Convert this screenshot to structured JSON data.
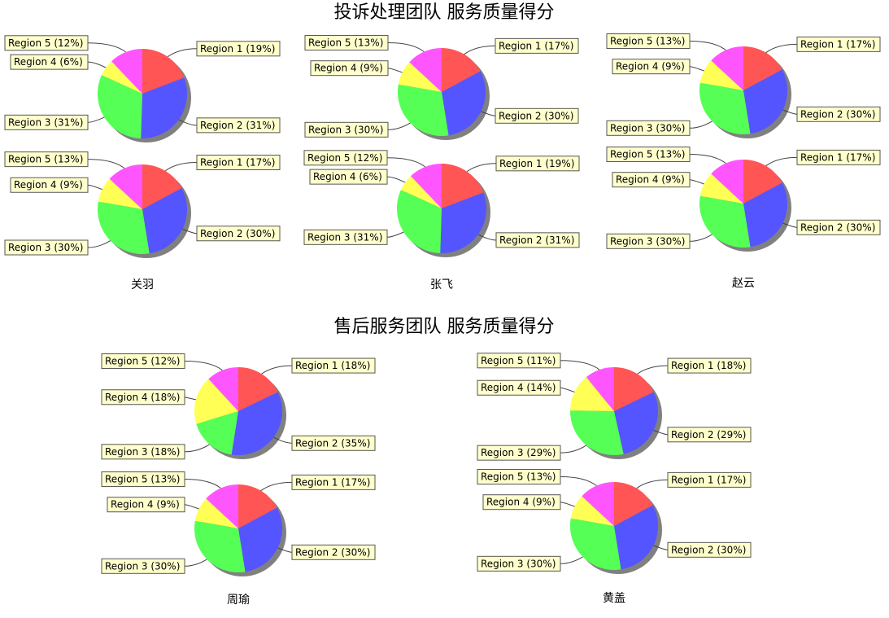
{
  "colors": {
    "Region 1": "#ff5555",
    "Region 2": "#5555ff",
    "Region 3": "#55ff55",
    "Region 4": "#ffff55",
    "Region 5": "#ff55ff",
    "label_fill": "#ffffcc"
  },
  "chart_data": [
    {
      "type": "pie",
      "title": "投诉处理团队 服务质量得分",
      "people": [
        {
          "name": "关羽",
          "pies": [
            {
              "labels": [
                "Region 1",
                "Region 2",
                "Region 3",
                "Region 4",
                "Region 5"
              ],
              "values": [
                19,
                31,
                31,
                6,
                12
              ],
              "label_text": [
                "Region 1 (19%)",
                "Region 2 (31%)",
                "Region 3 (31%)",
                "Region 4 (6%)",
                "Region 5 (12%)"
              ]
            },
            {
              "labels": [
                "Region 1",
                "Region 2",
                "Region 3",
                "Region 4",
                "Region 5"
              ],
              "values": [
                17,
                30,
                30,
                9,
                13
              ],
              "label_text": [
                "Region 1 (17%)",
                "Region 2 (30%)",
                "Region 3 (30%)",
                "Region 4 (9%)",
                "Region 5 (13%)"
              ]
            }
          ]
        },
        {
          "name": "张飞",
          "pies": [
            {
              "labels": [
                "Region 1",
                "Region 2",
                "Region 3",
                "Region 4",
                "Region 5"
              ],
              "values": [
                17,
                30,
                30,
                9,
                13
              ],
              "label_text": [
                "Region 1 (17%)",
                "Region 2 (30%)",
                "Region 3 (30%)",
                "Region 4 (9%)",
                "Region 5 (13%)"
              ]
            },
            {
              "labels": [
                "Region 1",
                "Region 2",
                "Region 3",
                "Region 4",
                "Region 5"
              ],
              "values": [
                19,
                31,
                31,
                6,
                12
              ],
              "label_text": [
                "Region 1 (19%)",
                "Region 2 (31%)",
                "Region 3 (31%)",
                "Region 4 (6%)",
                "Region 5 (12%)"
              ]
            }
          ]
        },
        {
          "name": "赵云",
          "pies": [
            {
              "labels": [
                "Region 1",
                "Region 2",
                "Region 3",
                "Region 4",
                "Region 5"
              ],
              "values": [
                17,
                30,
                30,
                9,
                13
              ],
              "label_text": [
                "Region 1 (17%)",
                "Region 2 (30%)",
                "Region 3 (30%)",
                "Region 4 (9%)",
                "Region 5 (13%)"
              ]
            },
            {
              "labels": [
                "Region 1",
                "Region 2",
                "Region 3",
                "Region 4",
                "Region 5"
              ],
              "values": [
                17,
                30,
                30,
                9,
                13
              ],
              "label_text": [
                "Region 1 (17%)",
                "Region 2 (30%)",
                "Region 3 (30%)",
                "Region 4 (9%)",
                "Region 5 (13%)"
              ]
            }
          ]
        }
      ]
    },
    {
      "type": "pie",
      "title": "售后服务团队 服务质量得分",
      "people": [
        {
          "name": "周瑜",
          "pies": [
            {
              "labels": [
                "Region 1",
                "Region 2",
                "Region 3",
                "Region 4",
                "Region 5"
              ],
              "values": [
                18,
                35,
                18,
                18,
                12
              ],
              "label_text": [
                "Region 1 (18%)",
                "Region 2 (35%)",
                "Region 3 (18%)",
                "Region 4 (18%)",
                "Region 5 (12%)"
              ]
            },
            {
              "labels": [
                "Region 1",
                "Region 2",
                "Region 3",
                "Region 4",
                "Region 5"
              ],
              "values": [
                17,
                30,
                30,
                9,
                13
              ],
              "label_text": [
                "Region 1 (17%)",
                "Region 2 (30%)",
                "Region 3 (30%)",
                "Region 4 (9%)",
                "Region 5 (13%)"
              ]
            }
          ]
        },
        {
          "name": "黄盖",
          "pies": [
            {
              "labels": [
                "Region 1",
                "Region 2",
                "Region 3",
                "Region 4",
                "Region 5"
              ],
              "values": [
                18,
                29,
                29,
                14,
                11
              ],
              "label_text": [
                "Region 1 (18%)",
                "Region 2 (29%)",
                "Region 3 (29%)",
                "Region 4 (14%)",
                "Region 5 (11%)"
              ]
            },
            {
              "labels": [
                "Region 1",
                "Region 2",
                "Region 3",
                "Region 4",
                "Region 5"
              ],
              "values": [
                17,
                30,
                30,
                9,
                13
              ],
              "label_text": [
                "Region 1 (17%)",
                "Region 2 (30%)",
                "Region 3 (30%)",
                "Region 4 (9%)",
                "Region 5 (13%)"
              ]
            }
          ]
        }
      ]
    }
  ]
}
